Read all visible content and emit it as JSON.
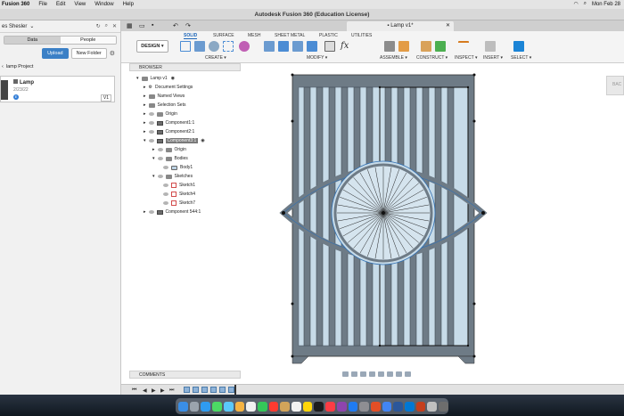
{
  "menubar": {
    "app": "Fusion 360",
    "items": [
      "File",
      "Edit",
      "View",
      "Window",
      "Help"
    ],
    "datetime": "Mon Feb 28"
  },
  "window": {
    "title": "Autodesk Fusion 360 (Education License)"
  },
  "left_panel": {
    "team": "es Shesler",
    "tabs": [
      "Data",
      "People"
    ],
    "upload_label": "Upload",
    "new_folder_label": "New Folder",
    "project": "lamp Project",
    "file": {
      "name": "Lamp",
      "date": "2/23/22",
      "version": "V1"
    }
  },
  "document_tab": {
    "label": "Lamp v1*"
  },
  "toolbar": {
    "design_label": "DESIGN",
    "workspace_tabs": [
      "SOLID",
      "SURFACE",
      "MESH",
      "SHEET METAL",
      "PLASTIC",
      "UTILITIES"
    ],
    "groups": [
      "CREATE",
      "MODIFY",
      "ASSEMBLE",
      "CONSTRUCT",
      "INSPECT",
      "INSERT",
      "SELECT"
    ]
  },
  "browser": {
    "title": "BROWSER",
    "items": [
      {
        "label": "Lamp v1"
      },
      {
        "label": "Document Settings"
      },
      {
        "label": "Named Views"
      },
      {
        "label": "Selection Sets"
      },
      {
        "label": "Origin"
      },
      {
        "label": "Component1:1"
      },
      {
        "label": "Component2:1"
      },
      {
        "label": "Component3:1"
      },
      {
        "label": "Origin"
      },
      {
        "label": "Bodies"
      },
      {
        "label": "Body1"
      },
      {
        "label": "Sketches"
      },
      {
        "label": "Sketch1"
      },
      {
        "label": "Sketch4"
      },
      {
        "label": "Sketch7"
      },
      {
        "label": "Component 544:1"
      }
    ]
  },
  "viewcube": {
    "label": "BAC"
  },
  "comments": {
    "title": "COMMENTS"
  },
  "colors": {
    "accent": "#1b64b8",
    "model_fill": "#c7dbe8",
    "model_dark": "#6e7b86",
    "sketch_line": "#2f6fb3"
  }
}
